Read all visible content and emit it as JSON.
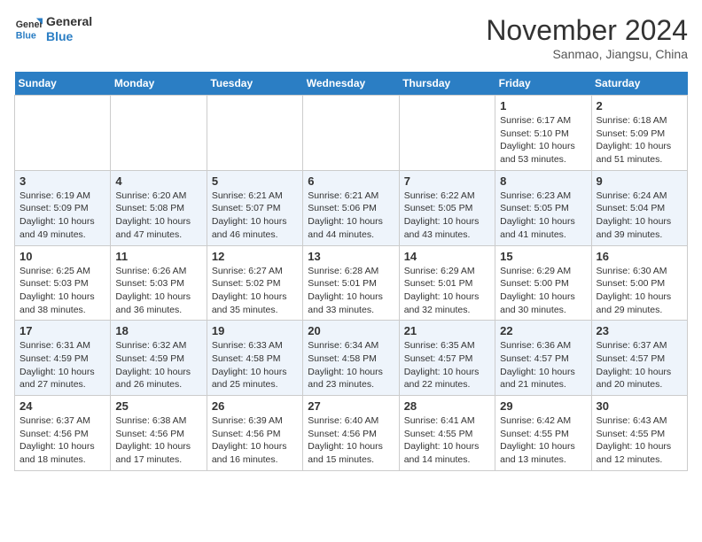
{
  "header": {
    "logo_line1": "General",
    "logo_line2": "Blue",
    "month": "November 2024",
    "location": "Sanmao, Jiangsu, China"
  },
  "weekdays": [
    "Sunday",
    "Monday",
    "Tuesday",
    "Wednesday",
    "Thursday",
    "Friday",
    "Saturday"
  ],
  "weeks": [
    [
      {
        "day": "",
        "info": ""
      },
      {
        "day": "",
        "info": ""
      },
      {
        "day": "",
        "info": ""
      },
      {
        "day": "",
        "info": ""
      },
      {
        "day": "",
        "info": ""
      },
      {
        "day": "1",
        "info": "Sunrise: 6:17 AM\nSunset: 5:10 PM\nDaylight: 10 hours\nand 53 minutes."
      },
      {
        "day": "2",
        "info": "Sunrise: 6:18 AM\nSunset: 5:09 PM\nDaylight: 10 hours\nand 51 minutes."
      }
    ],
    [
      {
        "day": "3",
        "info": "Sunrise: 6:19 AM\nSunset: 5:09 PM\nDaylight: 10 hours\nand 49 minutes."
      },
      {
        "day": "4",
        "info": "Sunrise: 6:20 AM\nSunset: 5:08 PM\nDaylight: 10 hours\nand 47 minutes."
      },
      {
        "day": "5",
        "info": "Sunrise: 6:21 AM\nSunset: 5:07 PM\nDaylight: 10 hours\nand 46 minutes."
      },
      {
        "day": "6",
        "info": "Sunrise: 6:21 AM\nSunset: 5:06 PM\nDaylight: 10 hours\nand 44 minutes."
      },
      {
        "day": "7",
        "info": "Sunrise: 6:22 AM\nSunset: 5:05 PM\nDaylight: 10 hours\nand 43 minutes."
      },
      {
        "day": "8",
        "info": "Sunrise: 6:23 AM\nSunset: 5:05 PM\nDaylight: 10 hours\nand 41 minutes."
      },
      {
        "day": "9",
        "info": "Sunrise: 6:24 AM\nSunset: 5:04 PM\nDaylight: 10 hours\nand 39 minutes."
      }
    ],
    [
      {
        "day": "10",
        "info": "Sunrise: 6:25 AM\nSunset: 5:03 PM\nDaylight: 10 hours\nand 38 minutes."
      },
      {
        "day": "11",
        "info": "Sunrise: 6:26 AM\nSunset: 5:03 PM\nDaylight: 10 hours\nand 36 minutes."
      },
      {
        "day": "12",
        "info": "Sunrise: 6:27 AM\nSunset: 5:02 PM\nDaylight: 10 hours\nand 35 minutes."
      },
      {
        "day": "13",
        "info": "Sunrise: 6:28 AM\nSunset: 5:01 PM\nDaylight: 10 hours\nand 33 minutes."
      },
      {
        "day": "14",
        "info": "Sunrise: 6:29 AM\nSunset: 5:01 PM\nDaylight: 10 hours\nand 32 minutes."
      },
      {
        "day": "15",
        "info": "Sunrise: 6:29 AM\nSunset: 5:00 PM\nDaylight: 10 hours\nand 30 minutes."
      },
      {
        "day": "16",
        "info": "Sunrise: 6:30 AM\nSunset: 5:00 PM\nDaylight: 10 hours\nand 29 minutes."
      }
    ],
    [
      {
        "day": "17",
        "info": "Sunrise: 6:31 AM\nSunset: 4:59 PM\nDaylight: 10 hours\nand 27 minutes."
      },
      {
        "day": "18",
        "info": "Sunrise: 6:32 AM\nSunset: 4:59 PM\nDaylight: 10 hours\nand 26 minutes."
      },
      {
        "day": "19",
        "info": "Sunrise: 6:33 AM\nSunset: 4:58 PM\nDaylight: 10 hours\nand 25 minutes."
      },
      {
        "day": "20",
        "info": "Sunrise: 6:34 AM\nSunset: 4:58 PM\nDaylight: 10 hours\nand 23 minutes."
      },
      {
        "day": "21",
        "info": "Sunrise: 6:35 AM\nSunset: 4:57 PM\nDaylight: 10 hours\nand 22 minutes."
      },
      {
        "day": "22",
        "info": "Sunrise: 6:36 AM\nSunset: 4:57 PM\nDaylight: 10 hours\nand 21 minutes."
      },
      {
        "day": "23",
        "info": "Sunrise: 6:37 AM\nSunset: 4:57 PM\nDaylight: 10 hours\nand 20 minutes."
      }
    ],
    [
      {
        "day": "24",
        "info": "Sunrise: 6:37 AM\nSunset: 4:56 PM\nDaylight: 10 hours\nand 18 minutes."
      },
      {
        "day": "25",
        "info": "Sunrise: 6:38 AM\nSunset: 4:56 PM\nDaylight: 10 hours\nand 17 minutes."
      },
      {
        "day": "26",
        "info": "Sunrise: 6:39 AM\nSunset: 4:56 PM\nDaylight: 10 hours\nand 16 minutes."
      },
      {
        "day": "27",
        "info": "Sunrise: 6:40 AM\nSunset: 4:56 PM\nDaylight: 10 hours\nand 15 minutes."
      },
      {
        "day": "28",
        "info": "Sunrise: 6:41 AM\nSunset: 4:55 PM\nDaylight: 10 hours\nand 14 minutes."
      },
      {
        "day": "29",
        "info": "Sunrise: 6:42 AM\nSunset: 4:55 PM\nDaylight: 10 hours\nand 13 minutes."
      },
      {
        "day": "30",
        "info": "Sunrise: 6:43 AM\nSunset: 4:55 PM\nDaylight: 10 hours\nand 12 minutes."
      }
    ]
  ]
}
